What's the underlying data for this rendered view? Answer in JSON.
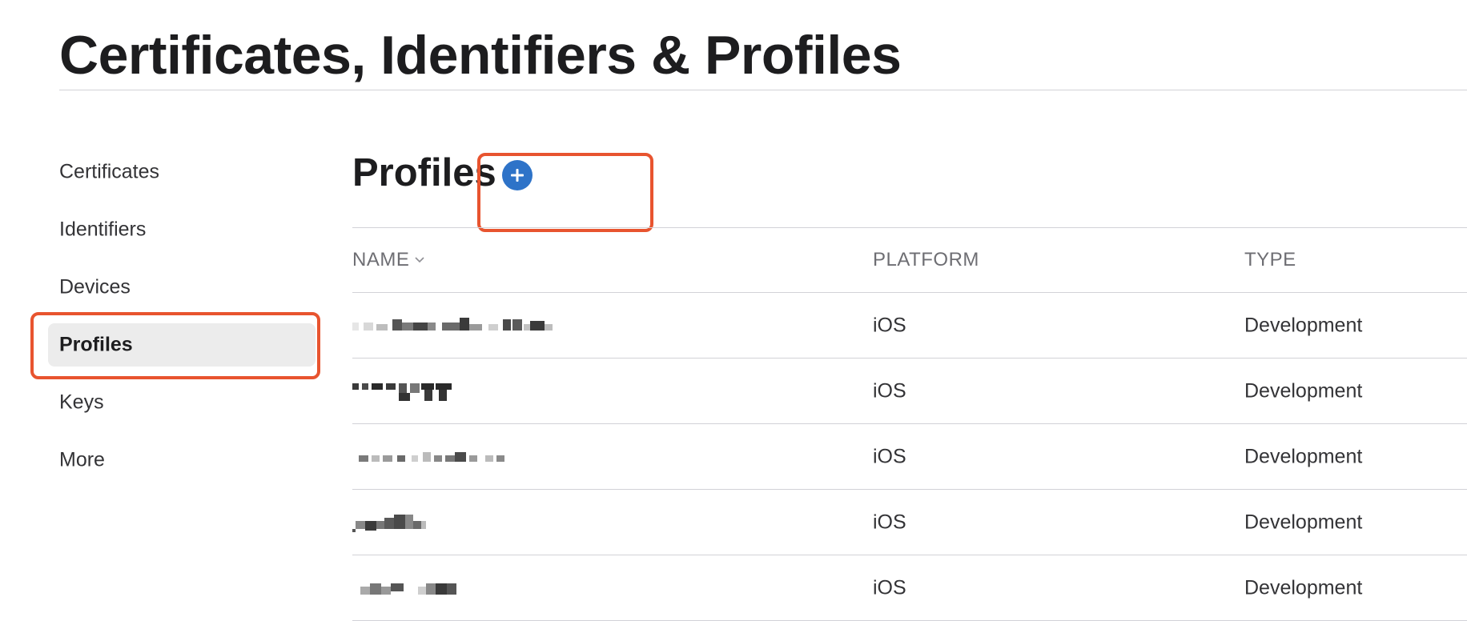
{
  "header": {
    "title": "Certificates, Identifiers & Profiles"
  },
  "sidebar": {
    "items": [
      {
        "label": "Certificates",
        "active": false
      },
      {
        "label": "Identifiers",
        "active": false
      },
      {
        "label": "Devices",
        "active": false
      },
      {
        "label": "Profiles",
        "active": true
      },
      {
        "label": "Keys",
        "active": false
      },
      {
        "label": "More",
        "active": false
      }
    ]
  },
  "main": {
    "section_title": "Profiles",
    "add_button_icon": "plus-circle-icon",
    "table": {
      "columns": [
        "NAME",
        "PLATFORM",
        "TYPE"
      ],
      "sort_icon": "chevron-down-icon",
      "rows": [
        {
          "name": "",
          "platform": "iOS",
          "type": "Development"
        },
        {
          "name": "",
          "platform": "iOS",
          "type": "Development"
        },
        {
          "name": "",
          "platform": "iOS",
          "type": "Development"
        },
        {
          "name": "",
          "platform": "iOS",
          "type": "Development"
        },
        {
          "name": "",
          "platform": "iOS",
          "type": "Development"
        }
      ]
    }
  },
  "colors": {
    "accent": "#2e73c8",
    "annotation": "#e8542f",
    "active_nav_bg": "#ececec",
    "divider": "#d2d2d7"
  }
}
